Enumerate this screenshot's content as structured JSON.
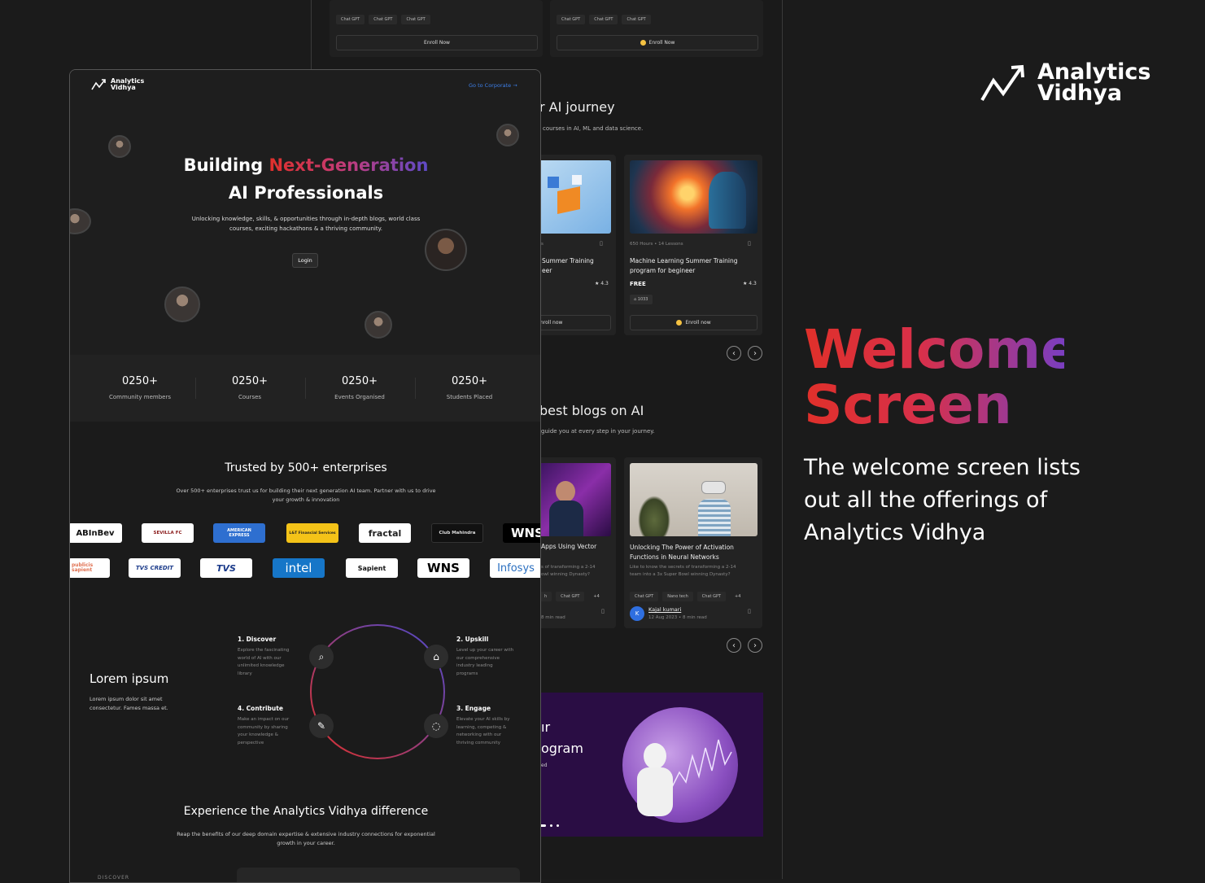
{
  "top_cards": {
    "tags": [
      "Chat GPT",
      "Chat GPT",
      "Chat GPT"
    ],
    "enroll_label": "Enroll Now"
  },
  "journey": {
    "title": "r AI journey",
    "subtitle": "courses in AI, ML and data science.",
    "card1": {
      "meta": "s",
      "title_line1": "Summer Training",
      "title_line2": "eer",
      "rating": "4.3",
      "enroll": "nroll now"
    },
    "card2": {
      "meta": "650 Hours • 14 Lessons",
      "title_line1": "Machine Learning Summer Training",
      "title_line2": "program for begineer",
      "price": "FREE",
      "rating": "4.3",
      "learners": "1033",
      "enroll": "Enroll now"
    }
  },
  "blogs": {
    "title": "best blogs on AI",
    "subtitle": "guide you at every step in your journey.",
    "card1": {
      "title": "Apps Using Vector",
      "desc_line1": "s of transforming a 2-14",
      "desc_line2": "owl winning Dynasty?",
      "tags": [
        "h",
        "Chat GPT",
        "+4"
      ],
      "read": "8 min read"
    },
    "card2": {
      "title_line1": "Unlocking The Power of Activation",
      "title_line2": "Functions in Neural Networks",
      "desc_line1": "Like to know the secrets of transforming a 2-14",
      "desc_line2": "team into a 3x Super Bowl winning Dynasty?",
      "tags": [
        "Chat GPT",
        "Nano tech",
        "Chat GPT",
        "+4"
      ],
      "author_initial": "K",
      "author": "Kajal kumari",
      "date": "12 Aug 2023 • 8 min read"
    }
  },
  "program": {
    "line1": "ır",
    "line2": "ogram",
    "line3": "ed"
  },
  "brand": {
    "line1": "Analytics",
    "line2": "Vidhya"
  },
  "welcome": {
    "title_line1": "Welcome",
    "title_line2": "Screen",
    "desc_line1": "The welcome screen lists",
    "desc_line2": "out all the offerings of",
    "desc_line3": "Analytics Vidhya"
  },
  "phone": {
    "logo_line1": "Analytics",
    "logo_line2": "Vidhya",
    "corporate_link": "Go to Corporate →",
    "hero_title_a": "Building",
    "hero_title_b": "Next-Generation",
    "hero_title_c": "AI Professionals",
    "hero_desc_line1": "Unlocking knowledge, skills, & opportunities through in-depth blogs, world class",
    "hero_desc_line2": "courses, exciting hackathons & a thriving community.",
    "login": "Login",
    "stats": [
      {
        "n": "0250+",
        "l": "Community members"
      },
      {
        "n": "0250+",
        "l": "Courses"
      },
      {
        "n": "0250+",
        "l": "Events Organised"
      },
      {
        "n": "0250+",
        "l": "Students Placed"
      }
    ],
    "trusted_title": "Trusted by 500+ enterprises",
    "trusted_desc_line1": "Over 500+ enterprises trust us for building their next generation AI team. Partner with us to drive",
    "trusted_desc_line2": "your growth & innovation",
    "logos_row1": [
      "ABInBev",
      "SEVILLA FC",
      "AMERICAN EXPRESS",
      "L&T Financial Services",
      "fractal",
      "Club Mahindra",
      "WNS"
    ],
    "logos_row2": [
      "publicis sapient",
      "TVS CREDIT",
      "TVS",
      "intel",
      "Sapient",
      "WNS",
      "Infosys"
    ],
    "lorem_title": "Lorem ipsum",
    "lorem_desc_line1": "Lorem ipsum dolor sit amet",
    "lorem_desc_line2": "consectetur. Fames massa et.",
    "steps": [
      {
        "t": "1. Discover",
        "d": [
          "Explore the fascinating",
          "world of AI with our",
          "unlimited knowledge",
          "library"
        ]
      },
      {
        "t": "2. Upskill",
        "d": [
          "Level up your career with",
          "our comprehensive",
          "industry leading",
          "programs"
        ]
      },
      {
        "t": "4. Contribute",
        "d": [
          "Make an impact on our",
          "community by sharing",
          "your knowledge &",
          "perspective"
        ]
      },
      {
        "t": "3. Engage",
        "d": [
          "Elevate your AI skills by",
          "learning, competing &",
          "networking with our",
          "thriving community"
        ]
      }
    ],
    "experience_title": "Experience the Analytics Vidhya difference",
    "experience_desc_line1": "Reap the benefits of our deep domain expertise & extensive industry connections for exponential",
    "experience_desc_line2": "growth in your career.",
    "discover_label": "DISCOVER"
  },
  "colors": {
    "red": "#e0302a",
    "purple": "#6a3ec0",
    "bg": "#1b1b1b"
  }
}
